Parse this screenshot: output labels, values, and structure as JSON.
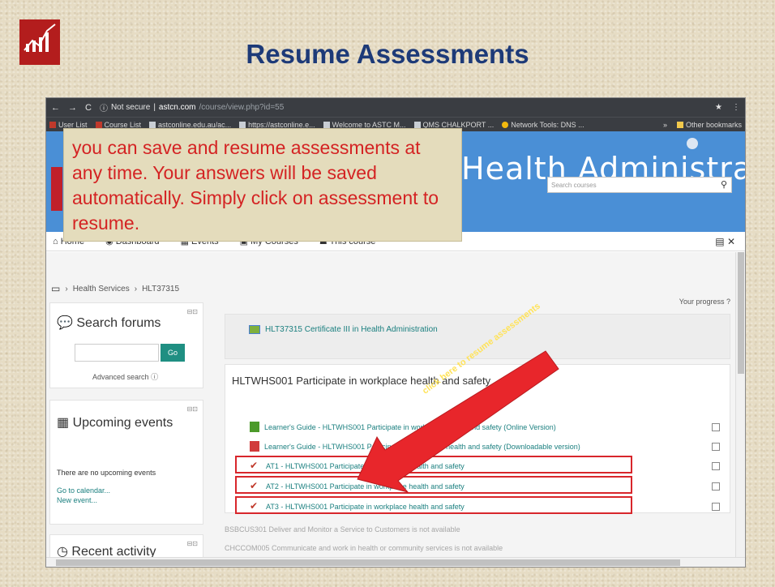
{
  "slide": {
    "title": "Resume Assessments"
  },
  "browser": {
    "security": "Not secure",
    "url_host": "astcn.com",
    "url_path": "/course/view.php?id=55",
    "bookmarks": [
      "User List",
      "Course List",
      "astconline.edu.au/ac...",
      "https://astconline.e...",
      "Welcome to ASTC M...",
      "QMS CHALKPORT ...",
      "Network Tools: DNS ..."
    ],
    "other_bookmarks": "Other bookmarks"
  },
  "site": {
    "title": "Health Administrat",
    "search_placeholder": "Search courses"
  },
  "callout": {
    "text": "you can save and resume assessments at any time. Your answers will be saved automatically. Simply click on assessment to resume."
  },
  "nav": {
    "items": [
      "Home",
      "Dashboard",
      "Events",
      "My Courses",
      "This course"
    ]
  },
  "breadcrumb": {
    "items": [
      "Health Services",
      "HLT37315"
    ]
  },
  "search_block": {
    "title": "Search forums",
    "go": "Go",
    "advanced": "Advanced search"
  },
  "events_block": {
    "title": "Upcoming events",
    "none": "There are no upcoming events",
    "calendar": "Go to calendar...",
    "new_event": "New event..."
  },
  "recent_block": {
    "title": "Recent activity"
  },
  "main": {
    "progress": "Your progress",
    "course": "HLT37315 Certificate III in Health Administration",
    "section": "HLTWHS001 Participate in workplace health and safety",
    "activities": [
      "Learner's Guide - HLTWHS001 Participate in workplace health and safety (Online Version)",
      "Learner's Guide - HLTWHS001 Participate in workplace health and safety (Downloadable version)",
      "AT1 - HLTWHS001 Participate in workplace health and safety",
      "AT2 - HLTWHS001 Participate in workplace health and safety",
      "AT3 - HLTWHS001 Participate in workplace health and safety"
    ],
    "unavailable": [
      "BSBCUS301 Deliver and Monitor a Service to Customers is not available",
      "CHCCOM005 Communicate and work in health or community services is not available"
    ]
  },
  "annotation": {
    "text": "click here to resume assessments"
  },
  "colors": {
    "title": "#1d3a78",
    "header": "#4a8fd6",
    "callout_text": "#d42323",
    "highlight": "#d8262b",
    "link": "#1a7f7f"
  }
}
